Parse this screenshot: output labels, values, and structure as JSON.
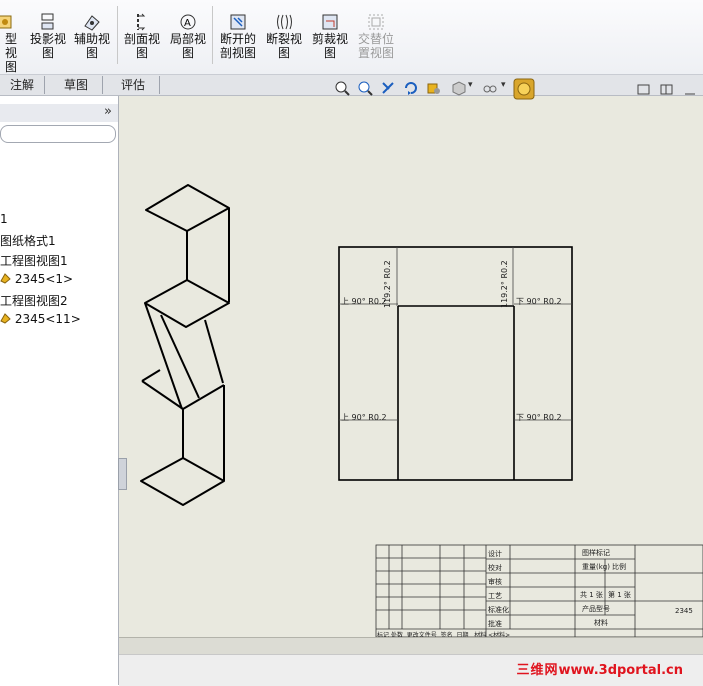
{
  "ribbon": {
    "buttons": [
      {
        "label": "型视\n图",
        "icon": "model-view-icon",
        "enabled": true
      },
      {
        "label": "投影视\n图",
        "icon": "projected-view-icon",
        "enabled": true
      },
      {
        "label": "辅助视\n图",
        "icon": "auxiliary-view-icon",
        "enabled": true
      },
      {
        "label": "剖面视\n图",
        "icon": "section-view-icon",
        "enabled": true
      },
      {
        "label": "局部视\n图",
        "icon": "detail-view-icon",
        "enabled": true
      },
      {
        "label": "断开的\n剖视图",
        "icon": "broken-out-section-icon",
        "enabled": true
      },
      {
        "label": "断裂视\n图",
        "icon": "break-view-icon",
        "enabled": true
      },
      {
        "label": "剪裁视\n图",
        "icon": "crop-view-icon",
        "enabled": true
      },
      {
        "label": "交替位\n置视图",
        "icon": "alternate-position-view-icon",
        "enabled": false
      }
    ]
  },
  "tabs": [
    "注解",
    "草图",
    "评估"
  ],
  "feature_tree": {
    "items": [
      "1",
      "图纸格式1",
      "工程图视图1",
      "2345<1>",
      "工程图视图2",
      "2345<11>"
    ]
  },
  "front_view": {
    "top_bend_left": "119.2° R0.2",
    "top_bend_right": "119.2° R0.2",
    "upper_left": "上 90° R0.2",
    "upper_right": "下 90° R0.2",
    "lower_left": "上 90° R0.2",
    "lower_right": "下 90° R0.2"
  },
  "title_block": {
    "labels": [
      "设计",
      "校对",
      "审核",
      "工艺",
      "标准化",
      "批准"
    ],
    "right_labels": [
      "图样标记",
      "重量(kg)",
      "比例",
      "共 1 张",
      "第 1 张",
      "产品型号",
      "材料"
    ],
    "footer": [
      "标记",
      "处数",
      "更改文件号",
      "签名",
      "日期",
      "材料 <材料>"
    ],
    "drawing_no": "2345"
  },
  "watermark": {
    "cn": "三维网",
    "url": "www.3dportal.cn"
  },
  "colors": {
    "sheet": "#e9e9df",
    "line": "#000000",
    "accent": "#e0141e"
  }
}
